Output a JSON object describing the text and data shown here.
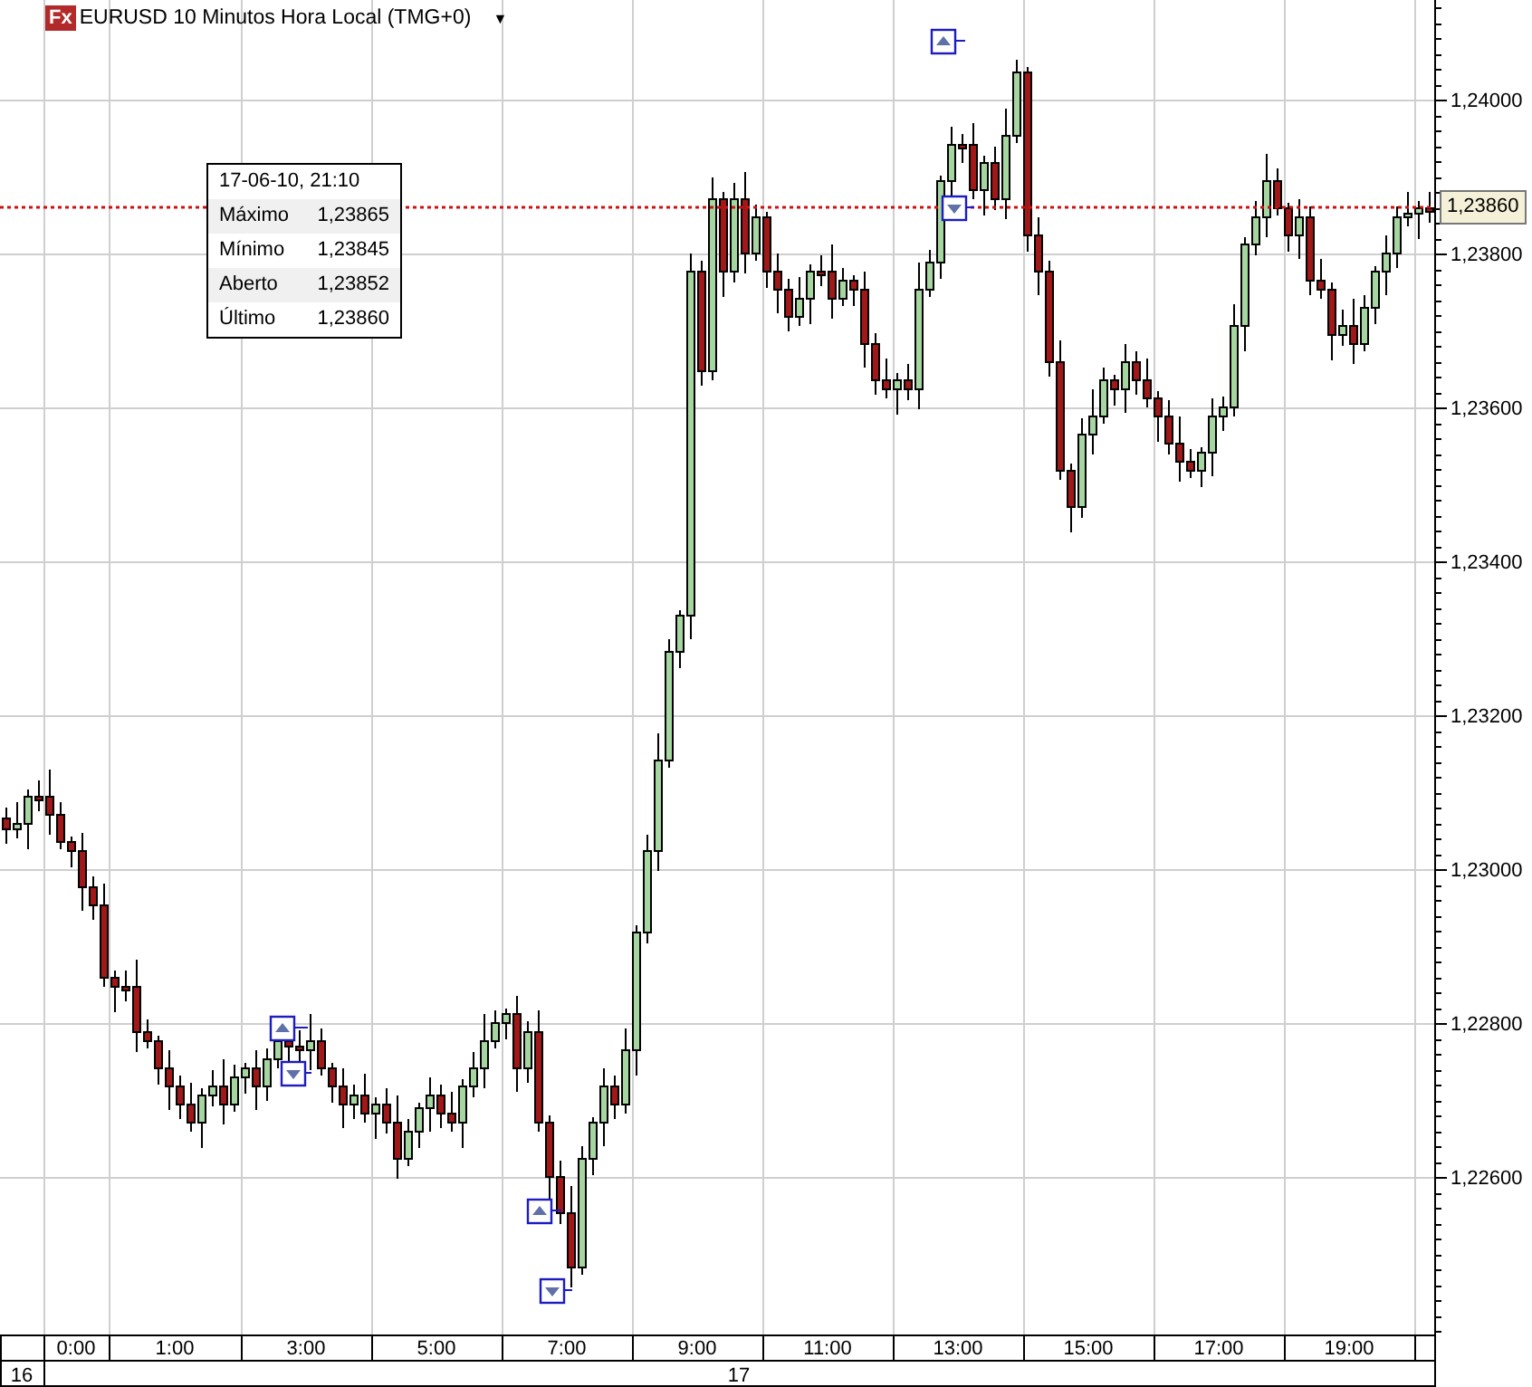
{
  "chart": {
    "logo": "Fx",
    "title": "EURUSD 10 Minutos Hora Local (TMG+0)",
    "menu_caret": "▼",
    "price_axis": {
      "labels": [
        "1,24000",
        "1,23800",
        "1,23600",
        "1,23400",
        "1,23200",
        "1,23000",
        "1,22800",
        "1,22600"
      ],
      "current_price": "1,23860"
    },
    "time_axis": {
      "hours": [
        "0:00",
        "1:00",
        "3:00",
        "5:00",
        "7:00",
        "9:00",
        "11:00",
        "13:00",
        "15:00",
        "17:00",
        "19:00"
      ],
      "days": [
        "16",
        "17"
      ]
    },
    "tooltip": {
      "header": "17-06-10, 21:10",
      "rows": [
        {
          "label": "Máximo",
          "value": "1,23865"
        },
        {
          "label": "Mínimo",
          "value": "1,23845"
        },
        {
          "label": "Aberto",
          "value": "1,23852"
        },
        {
          "label": "Último",
          "value": "1,23860"
        }
      ]
    },
    "trade_markers": [
      {
        "kind": "up"
      },
      {
        "kind": "down"
      },
      {
        "kind": "up"
      },
      {
        "kind": "down"
      },
      {
        "kind": "up"
      },
      {
        "kind": "down"
      }
    ]
  }
}
